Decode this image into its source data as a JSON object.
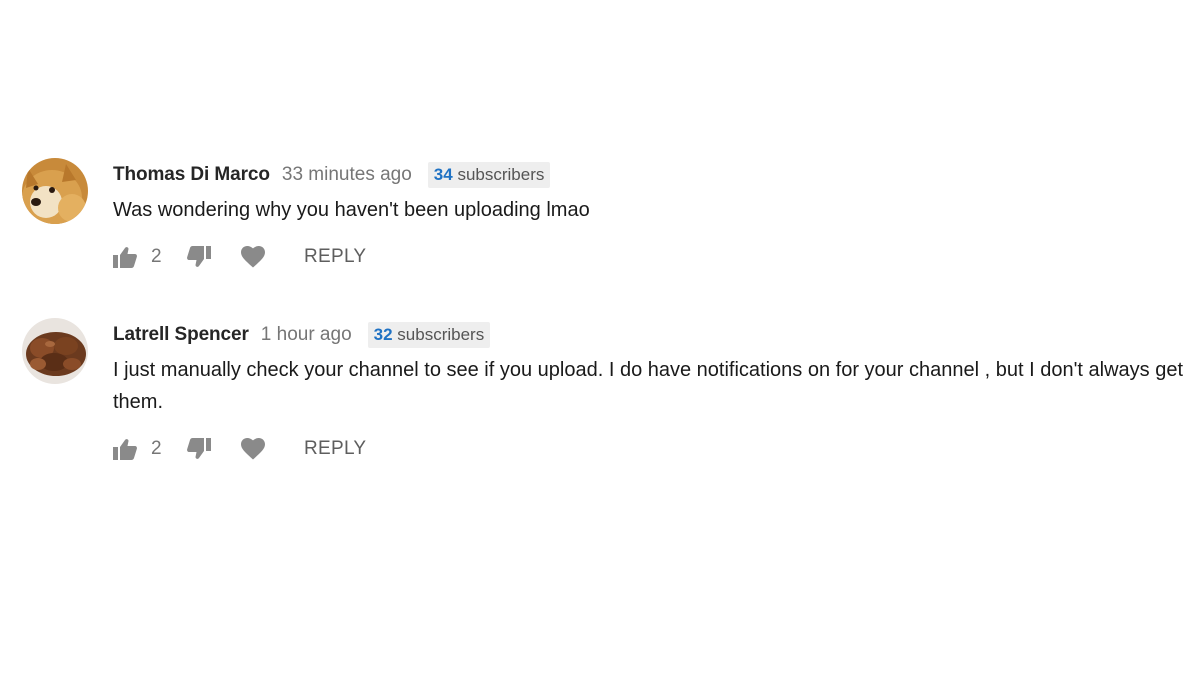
{
  "comments": [
    {
      "author": "Thomas Di Marco",
      "time": "33 minutes ago",
      "subscriber_count": "34",
      "subscriber_label": "subscribers",
      "text": "Was wondering why you haven't been uploading lmao",
      "likes": "2",
      "reply_label": "REPLY",
      "avatar_icon": "doge-avatar"
    },
    {
      "author": "Latrell Spencer",
      "time": "1 hour ago",
      "subscriber_count": "32",
      "subscriber_label": "subscribers",
      "text": "I just manually check your channel to see if you upload. I do have notifications on for your channel , but I don't always get them.",
      "likes": "2",
      "reply_label": "REPLY",
      "avatar_icon": "brown-object-avatar"
    }
  ],
  "colors": {
    "subscriber_count": "#1f72c4",
    "badge_background": "#eeeeee",
    "icon_gray": "#8a8a8a",
    "meta_gray": "#767676"
  }
}
